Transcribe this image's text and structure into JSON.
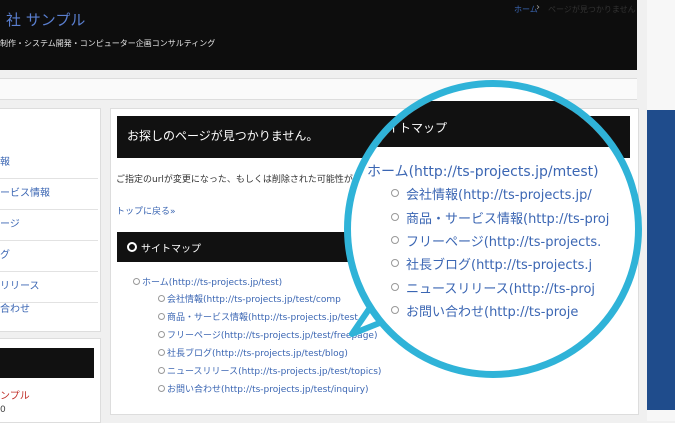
{
  "header": {
    "site_title": "社 サンプル",
    "tagline": "制作・システム開発・コンピューター企画コンサルティング"
  },
  "breadcrumb": {
    "home": "ホーム",
    "separator": "›",
    "current": "ページが見つかりません"
  },
  "sidebar": {
    "items": [
      {
        "label": "報"
      },
      {
        "label": "ービス情報"
      },
      {
        "label": "ージ"
      },
      {
        "label": "グ"
      },
      {
        "label": "リリース"
      },
      {
        "label": "合わせ"
      }
    ],
    "widget_red_text": "ンプル",
    "widget_number": "0"
  },
  "main": {
    "notfound_title": "お探しのページが見つかりません。",
    "error_desc": "ご指定のurlが変更になった、もしくは削除された可能性が",
    "back_link": "トップに戻る»",
    "sitemap_title": "サイトマップ",
    "sitemap": {
      "top": "ホーム(http://ts-projects.jp/test)",
      "children": [
        "会社情報(http://ts-projects.jp/test/comp",
        "商品・サービス情報(http://ts-projects.jp/test",
        "フリーページ(http://ts-projects.jp/test/freepage)",
        "社長ブログ(http://ts-projects.jp/test/blog)",
        "ニュースリリース(http://ts-projects.jp/test/topics)",
        "お問い合わせ(http://ts-projects.jp/test/inquiry)"
      ]
    }
  },
  "magnifier": {
    "bar_title": "サイトマップ",
    "top": "ホーム(http://ts-projects.jp/mtest)",
    "children": [
      "会社情報(http://ts-projects.jp/",
      "商品・サービス情報(http://ts-proj",
      "フリーページ(http://ts-projects.",
      "社長ブログ(http://ts-projects.j",
      "ニュースリリース(http://ts-proj",
      "お問い合わせ(http://ts-proje"
    ]
  },
  "colors": {
    "accent": "#2fb3d8",
    "link": "#3b66b3",
    "brand_blue": "#1f4c8c"
  }
}
